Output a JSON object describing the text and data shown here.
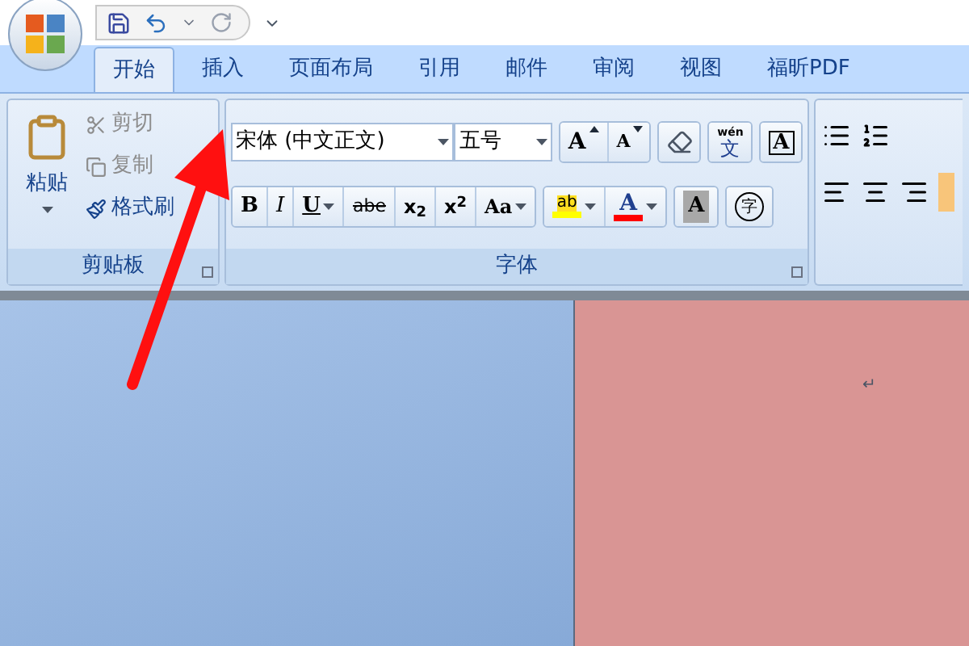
{
  "tabs": [
    {
      "label": "开始",
      "selected": true
    },
    {
      "label": "插入",
      "selected": false
    },
    {
      "label": "页面布局",
      "selected": false
    },
    {
      "label": "引用",
      "selected": false
    },
    {
      "label": "邮件",
      "selected": false
    },
    {
      "label": "审阅",
      "selected": false
    },
    {
      "label": "视图",
      "selected": false
    },
    {
      "label": "福昕PDF",
      "selected": false
    }
  ],
  "clipboard": {
    "paste": "粘贴",
    "items": [
      {
        "label": "剪切",
        "disabled": true,
        "kind": "cut"
      },
      {
        "label": "复制",
        "disabled": true,
        "kind": "copy"
      },
      {
        "label": "格式刷",
        "disabled": false,
        "kind": "painter"
      }
    ],
    "group_label": "剪贴板"
  },
  "font": {
    "font_name": "宋体 (中文正文)",
    "font_size": "五号",
    "group_label": "字体",
    "row1": [
      [
        {
          "kind": "grow",
          "label": "A"
        },
        {
          "kind": "shrink",
          "label": "A"
        }
      ],
      [
        {
          "kind": "clear"
        }
      ],
      [
        {
          "kind": "phonetic",
          "label": "wén",
          "label2": "文"
        }
      ],
      [
        {
          "kind": "border",
          "label": "A"
        }
      ]
    ],
    "row2": [
      [
        {
          "kind": "bold",
          "label": "B"
        },
        {
          "kind": "italic",
          "label": "I"
        },
        {
          "kind": "underline",
          "label": "U",
          "dropdown": true
        },
        {
          "kind": "strike",
          "label": "abe"
        },
        {
          "kind": "script",
          "label": "x$_{2}$"
        },
        {
          "kind": "script",
          "label": "x$^{2}$"
        },
        {
          "kind": "case",
          "label": "Aa",
          "dropdown": true
        }
      ],
      [
        {
          "kind": "highlight",
          "label": "ab",
          "dropdown": true
        },
        {
          "kind": "color",
          "label": "A",
          "dropdown": true
        }
      ],
      [
        {
          "kind": "shading",
          "label": "A"
        }
      ],
      [
        {
          "kind": "enclose",
          "label": "字"
        }
      ]
    ]
  },
  "document": {
    "paragraph_mark": "↵"
  }
}
